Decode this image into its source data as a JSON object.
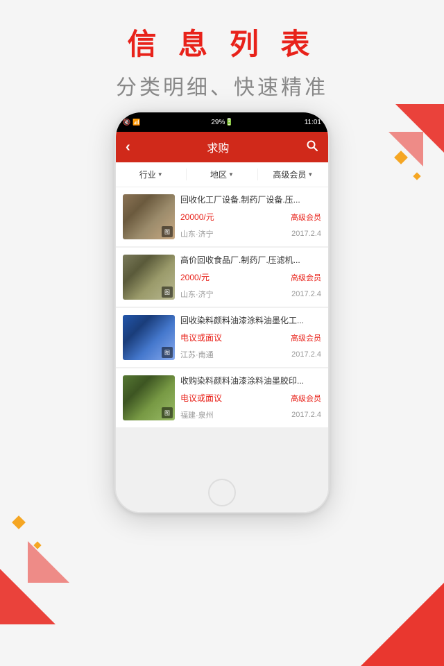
{
  "page": {
    "title": "信 息 列 表",
    "subtitle": "分类明细、快速精准"
  },
  "phone": {
    "statusBar": {
      "icons": "🔇 📶 29%",
      "time": "11:01"
    },
    "navbar": {
      "backLabel": "‹",
      "title": "求购",
      "searchIcon": "search"
    },
    "filters": [
      {
        "label": "行业",
        "arrow": "▼"
      },
      {
        "label": "地区",
        "arrow": "▼"
      },
      {
        "label": "高级会员",
        "arrow": "▼"
      }
    ],
    "listItems": [
      {
        "id": 1,
        "title": "回收化工厂设备.制药厂设备.压...",
        "price": "20000/元",
        "badge": "高级会员",
        "location": "山东·济宁",
        "date": "2017.2.4",
        "imgClass": "img-1"
      },
      {
        "id": 2,
        "title": "高价回收食品厂.制药厂.压滤机...",
        "price": "2000/元",
        "badge": "高级会员",
        "location": "山东·济宁",
        "date": "2017.2.4",
        "imgClass": "img-2"
      },
      {
        "id": 3,
        "title": "回收染料颜料油漆涂料油墨化工...",
        "price": "电议或面议",
        "badge": "高级会员",
        "location": "江苏·南通",
        "date": "2017.2.4",
        "imgClass": "img-3"
      },
      {
        "id": 4,
        "title": "收购染料颜料油漆涂料油墨胶印...",
        "price": "电议或面议",
        "badge": "高级会员",
        "location": "福建·泉州",
        "date": "2017.2.4",
        "imgClass": "img-4"
      }
    ]
  },
  "decorations": {
    "imageBadgeLabel": "图"
  }
}
